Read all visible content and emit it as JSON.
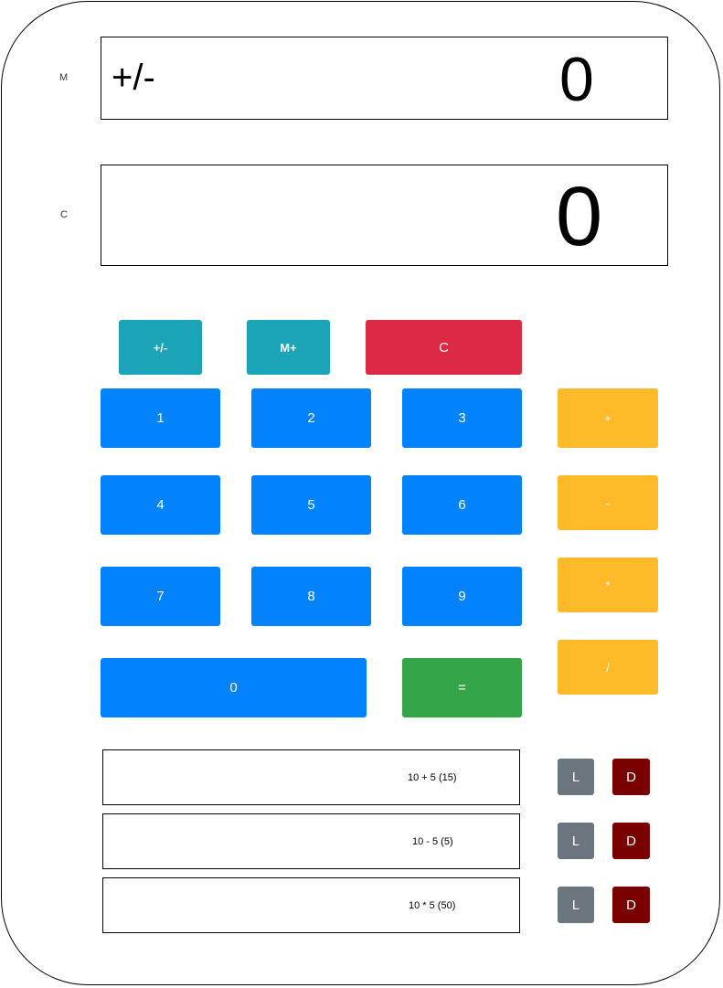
{
  "labels": {
    "memory": "M",
    "current": "C"
  },
  "memory_display": {
    "operator": "+/-",
    "value": "0"
  },
  "current_display": {
    "value": "0"
  },
  "buttons": {
    "plus_minus": "+/-",
    "memory_plus": "M+",
    "clear": "C",
    "one": "1",
    "two": "2",
    "three": "3",
    "four": "4",
    "five": "5",
    "six": "6",
    "seven": "7",
    "eight": "8",
    "nine": "9",
    "zero": "0",
    "equals": "=",
    "add": "+",
    "subtract": "-",
    "multiply": "*",
    "divide": "/"
  },
  "history": [
    {
      "expression": "10 + 5 (15)",
      "load_label": "L",
      "delete_label": "D"
    },
    {
      "expression": "10 - 5 (5)",
      "load_label": "L",
      "delete_label": "D"
    },
    {
      "expression": "10 * 5 (50)",
      "load_label": "L",
      "delete_label": "D"
    }
  ],
  "colors": {
    "teal": "#1ba3b8",
    "red": "#dc2a45",
    "blue": "#0283fb",
    "green": "#33a548",
    "yellow": "#ffba2a",
    "gray": "#6c757d",
    "maroon": "#7a0000"
  }
}
